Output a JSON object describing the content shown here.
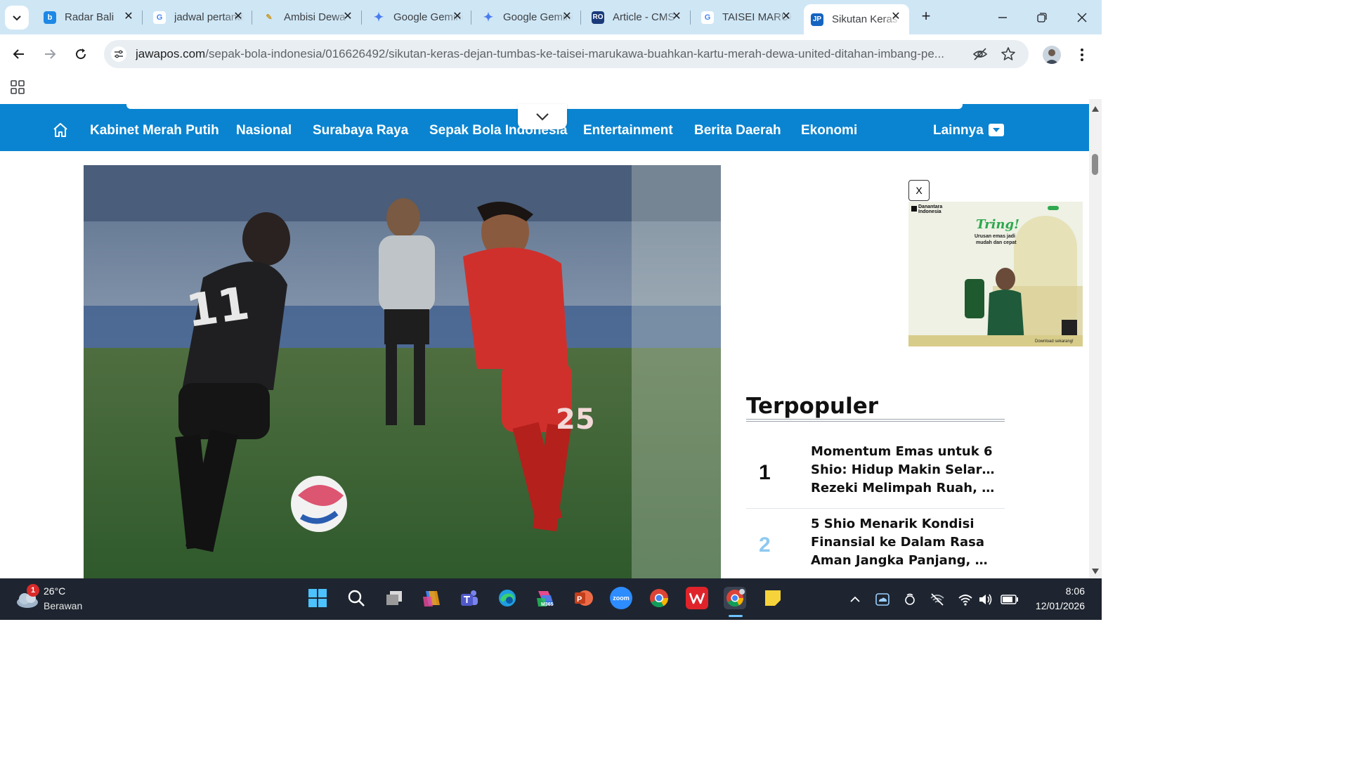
{
  "browser": {
    "tabs": [
      {
        "title": "Radar Bali",
        "favicon": "radar-bali-favicon"
      },
      {
        "title": "jadwal pertandingan",
        "favicon": "google-favicon"
      },
      {
        "title": "Ambisi Dewa",
        "favicon": "pen-favicon"
      },
      {
        "title": "Google Gemini",
        "favicon": "gemini-favicon"
      },
      {
        "title": "Google Gemini",
        "favicon": "gemini-favicon"
      },
      {
        "title": "Article - CMS",
        "favicon": "ro-favicon"
      },
      {
        "title": "TAISEI MARUKAWA",
        "favicon": "google-favicon"
      },
      {
        "title": "Sikutan Keras",
        "favicon": "jawapos-favicon",
        "active": true
      }
    ],
    "url_domain": "jawapos.com",
    "url_path": "/sepak-bola-indonesia/016626492/sikutan-keras-dejan-tumbas-ke-taisei-marukawa-buahkan-kartu-merah-dewa-united-ditahan-imbang-pe..."
  },
  "site": {
    "brand_color": "#0a84d0",
    "nav_items": [
      "Kabinet Merah Putih",
      "Nasional",
      "Surabaya Raya",
      "Sepak Bola Indonesia",
      "Entertainment",
      "Berita Daerah",
      "Ekonomi"
    ],
    "more_label": "Lainnya"
  },
  "ad": {
    "close_label": "X",
    "brand": "Danantara Indonesia",
    "headline": "Tring!",
    "tagline_1": "Urusan emas jadi",
    "tagline_2": "mudah dan cepat",
    "cta": "Download sekarang!"
  },
  "popular": {
    "title": "Terpopuler",
    "items": [
      {
        "rank": "1",
        "line1": "Momentum Emas untuk 6",
        "line2": "Shio: Hidup Makin Selaras,",
        "line3": "Rezeki Melimpah Ruah, dan...",
        "color": "#111111"
      },
      {
        "rank": "2",
        "line1": "5 Shio Menarik Kondisi",
        "line2": "Finansial ke Dalam Rasa",
        "line3": "Aman Jangka Panjang, Hok...",
        "color": "#8ec9f0"
      }
    ]
  },
  "taskbar": {
    "weather_temp": "26°C",
    "weather_desc": "Berawan",
    "weather_badge": "1",
    "apps": [
      "start-icon",
      "search-icon",
      "task-view-icon",
      "copilot-icon",
      "teams-icon",
      "edge-icon",
      "m365-icon",
      "powerpoint-icon",
      "zoom-icon",
      "chrome-icon",
      "wps-icon",
      "chrome-profile-icon",
      "sticky-notes-icon"
    ],
    "m365_label": "M365",
    "zoom_label": "zoom",
    "time": "8:06",
    "date": "12/01/2026"
  }
}
